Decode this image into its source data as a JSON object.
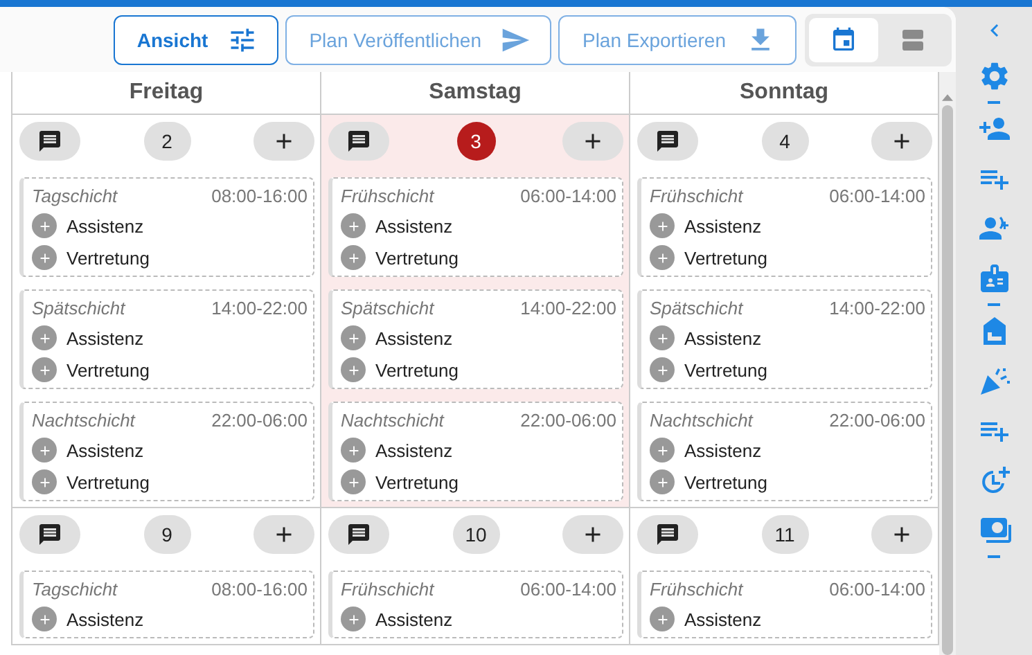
{
  "toolbar": {
    "buttons": [
      {
        "label": "Ansicht",
        "disabled": false
      },
      {
        "label": "Plan Veröffentlichen",
        "disabled": true
      },
      {
        "label": "Plan Exportieren",
        "disabled": true
      }
    ],
    "view_toggle": [
      {
        "selected": true
      },
      {
        "selected": false
      }
    ]
  },
  "days": [
    "Freitag",
    "Samstag",
    "Sonntag"
  ],
  "weeks": [
    {
      "days": [
        {
          "number": "2",
          "today": false,
          "shifts": [
            {
              "name": "Tagschicht",
              "time": "08:00-16:00",
              "roles": [
                "Assistenz",
                "Vertretung"
              ]
            },
            {
              "name": "Spätschicht",
              "time": "14:00-22:00",
              "roles": [
                "Assistenz",
                "Vertretung"
              ]
            },
            {
              "name": "Nachtschicht",
              "time": "22:00-06:00",
              "roles": [
                "Assistenz",
                "Vertretung"
              ]
            }
          ]
        },
        {
          "number": "3",
          "today": true,
          "shifts": [
            {
              "name": "Frühschicht",
              "time": "06:00-14:00",
              "roles": [
                "Assistenz",
                "Vertretung"
              ]
            },
            {
              "name": "Spätschicht",
              "time": "14:00-22:00",
              "roles": [
                "Assistenz",
                "Vertretung"
              ]
            },
            {
              "name": "Nachtschicht",
              "time": "22:00-06:00",
              "roles": [
                "Assistenz",
                "Vertretung"
              ]
            }
          ]
        },
        {
          "number": "4",
          "today": false,
          "shifts": [
            {
              "name": "Frühschicht",
              "time": "06:00-14:00",
              "roles": [
                "Assistenz",
                "Vertretung"
              ]
            },
            {
              "name": "Spätschicht",
              "time": "14:00-22:00",
              "roles": [
                "Assistenz",
                "Vertretung"
              ]
            },
            {
              "name": "Nachtschicht",
              "time": "22:00-06:00",
              "roles": [
                "Assistenz",
                "Vertretung"
              ]
            }
          ]
        }
      ]
    },
    {
      "days": [
        {
          "number": "9",
          "today": false,
          "shifts": [
            {
              "name": "Tagschicht",
              "time": "08:00-16:00",
              "roles": [
                "Assistenz"
              ]
            }
          ]
        },
        {
          "number": "10",
          "today": false,
          "shifts": [
            {
              "name": "Frühschicht",
              "time": "06:00-14:00",
              "roles": [
                "Assistenz"
              ]
            }
          ]
        },
        {
          "number": "11",
          "today": false,
          "shifts": [
            {
              "name": "Frühschicht",
              "time": "06:00-14:00",
              "roles": [
                "Assistenz"
              ]
            }
          ]
        }
      ]
    }
  ]
}
